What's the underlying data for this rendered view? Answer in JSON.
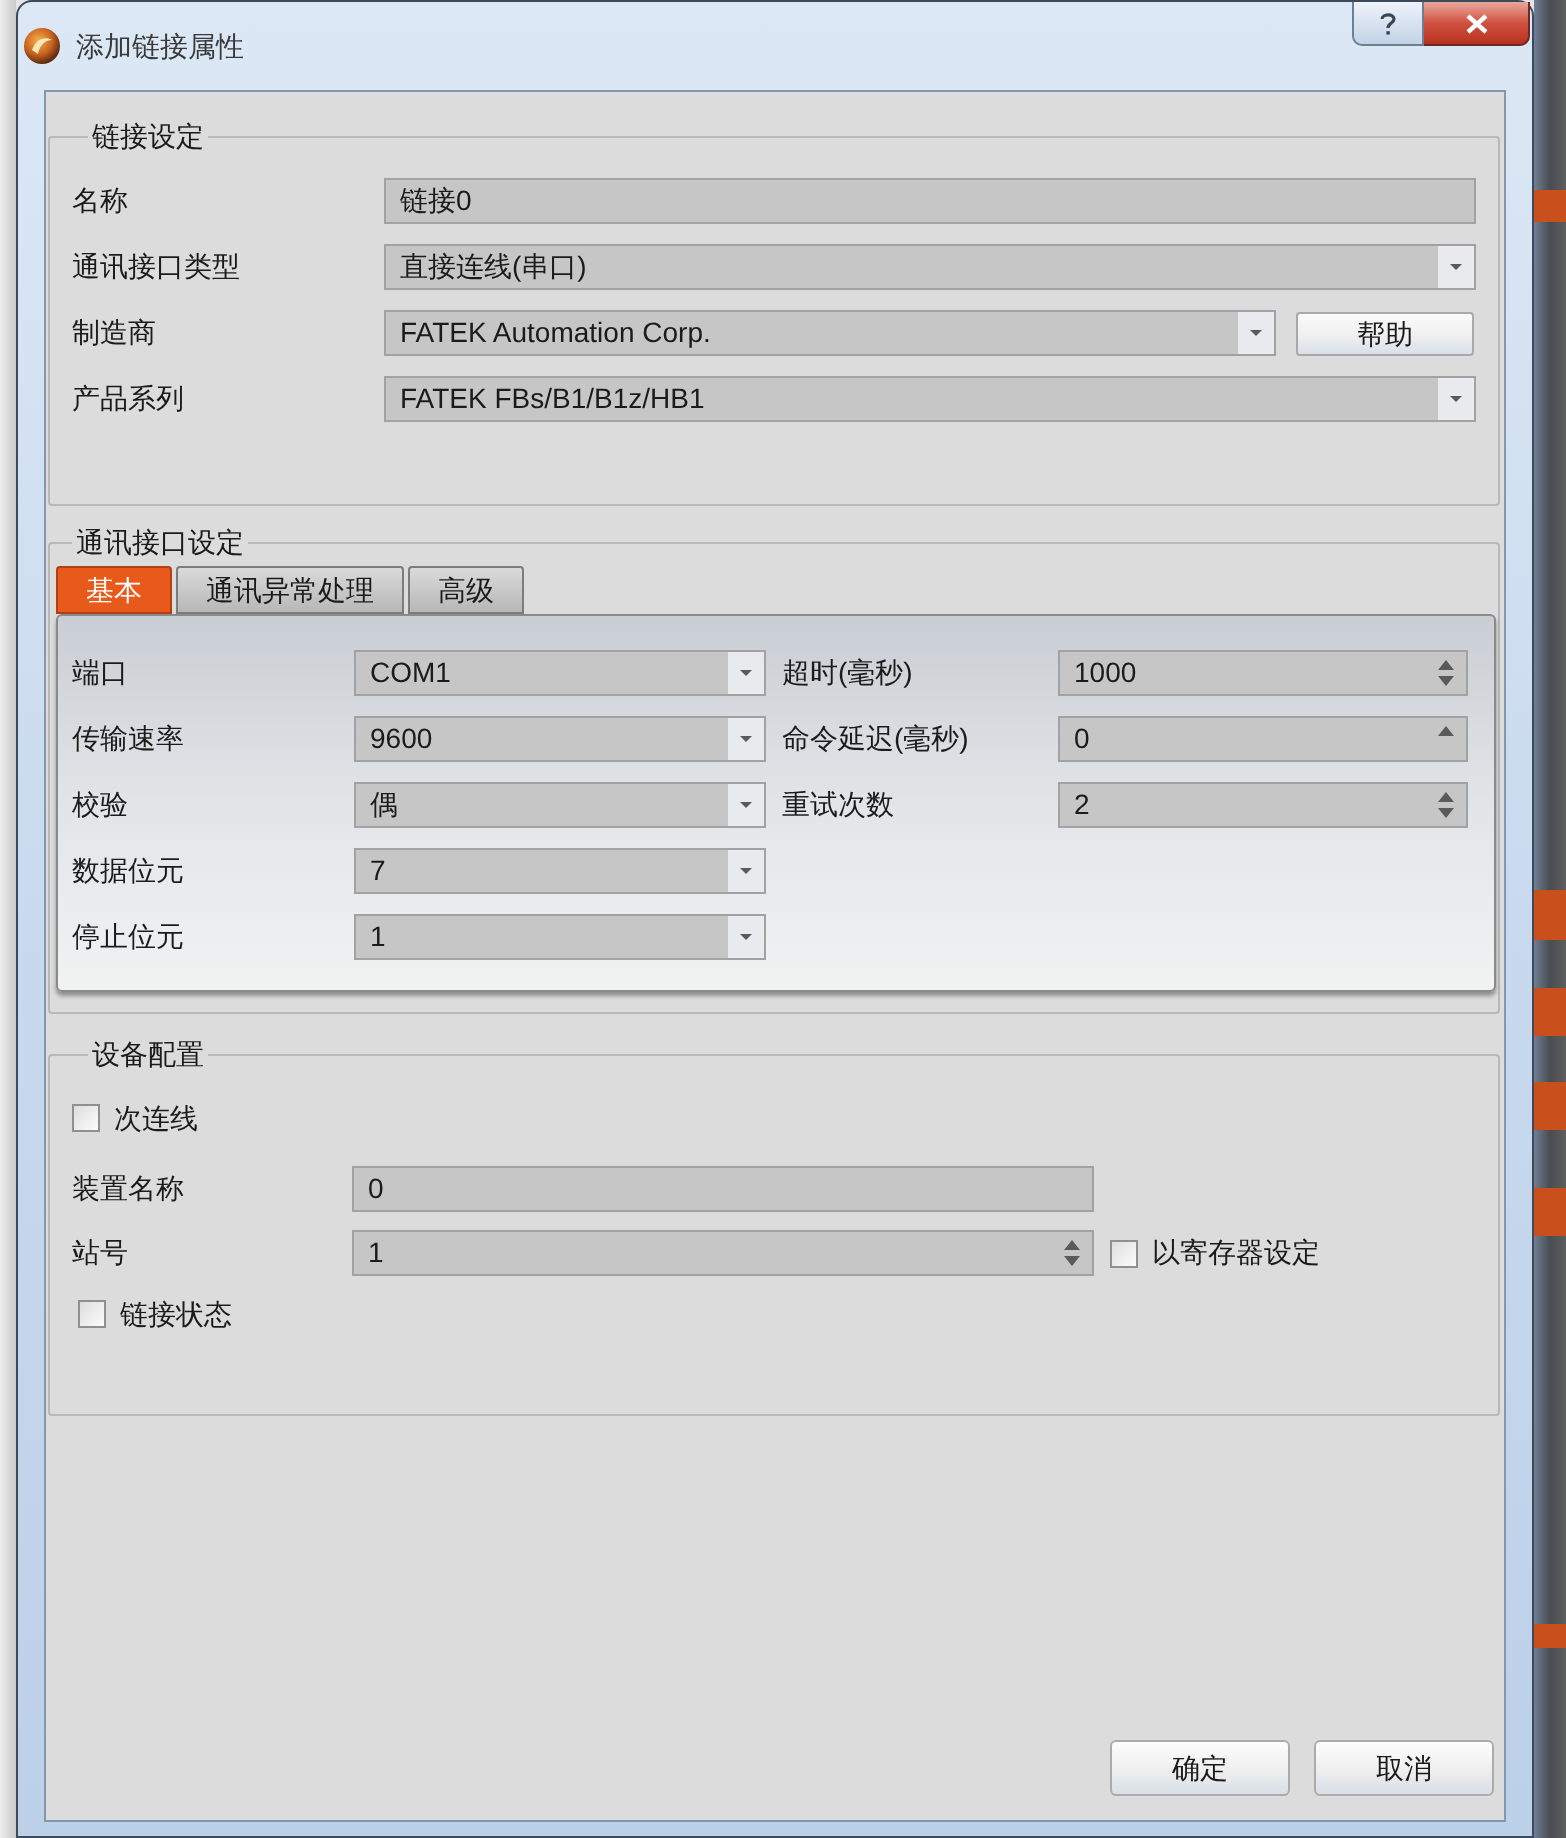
{
  "window": {
    "title": "添加链接属性"
  },
  "link_settings": {
    "title": "链接设定",
    "fields": [
      {
        "label": "名称",
        "kind": "text",
        "value": "链接0"
      },
      {
        "label": "通讯接口类型",
        "kind": "combo",
        "value": "直接连线(串口)"
      },
      {
        "label": "制造商",
        "kind": "combo",
        "value": "FATEK Automation Corp.",
        "button": "帮助"
      },
      {
        "label": "产品系列",
        "kind": "combo",
        "value": "FATEK FBs/B1/B1z/HB1"
      }
    ]
  },
  "comm_settings": {
    "title": "通讯接口设定",
    "tabs": [
      {
        "label": "基本",
        "selected": true
      },
      {
        "label": "通讯异常处理",
        "selected": false
      },
      {
        "label": "高级",
        "selected": false
      }
    ],
    "left_fields": [
      {
        "label": "端口",
        "kind": "combo",
        "value": "COM1"
      },
      {
        "label": "传输速率",
        "kind": "combo",
        "value": "9600"
      },
      {
        "label": "校验",
        "kind": "combo",
        "value": "偶"
      },
      {
        "label": "数据位元",
        "kind": "combo",
        "value": "7"
      },
      {
        "label": "停止位元",
        "kind": "combo",
        "value": "1"
      }
    ],
    "right_fields": [
      {
        "label": "超时(毫秒)",
        "kind": "spin",
        "value": "1000",
        "down_enabled": true
      },
      {
        "label": "命令延迟(毫秒)",
        "kind": "spin",
        "value": "0",
        "down_enabled": false
      },
      {
        "label": "重试次数",
        "kind": "spin",
        "value": "2",
        "down_enabled": true
      }
    ]
  },
  "device_settings": {
    "title": "设备配置",
    "secondary_link": {
      "label": "次连线",
      "checked": false
    },
    "fields": [
      {
        "label": "装置名称",
        "kind": "text",
        "value": "0"
      },
      {
        "label": "站号",
        "kind": "spin",
        "value": "1",
        "down_enabled": true,
        "option": {
          "label": "以寄存器设定",
          "checked": false
        }
      }
    ],
    "link_status": {
      "label": "链接状态",
      "checked": false
    }
  },
  "buttons": [
    {
      "label": "确定"
    },
    {
      "label": "取消"
    }
  ]
}
